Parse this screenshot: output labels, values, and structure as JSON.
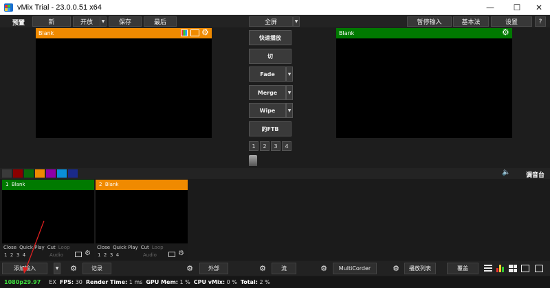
{
  "window": {
    "title": "vMix Trial - 23.0.0.51 x64",
    "min": "—",
    "max": "☐",
    "close": "✕"
  },
  "menubar": {
    "preview_label": "预置",
    "new_label": "新",
    "open_label": "开放",
    "save_label": "保存",
    "recent_label": "最后",
    "fullscreen_label": "全屏",
    "pause_input_label": "暂停输入",
    "basic_label": "基本法",
    "settings_label": "设置",
    "help_label": "?"
  },
  "preview": {
    "title": "Blank",
    "color": "#f08a00"
  },
  "output": {
    "title": "Blank",
    "color": "#007a00"
  },
  "transitions": {
    "quick_play": "快速播放",
    "cut": "切",
    "t1": "Fade",
    "t2": "Merge",
    "t3": "Wipe",
    "ftb": "的FTB",
    "numbers": [
      "1",
      "2",
      "3",
      "4"
    ]
  },
  "swatches": [
    "#3a3a3a",
    "#8b0000",
    "#0a6a0a",
    "#f08a00",
    "#8e00a8",
    "#0a8fd8",
    "#1a2a8a"
  ],
  "audio": {
    "label": "调音台"
  },
  "inputs": [
    {
      "num": "1",
      "name": "Blank",
      "color": "#007a00",
      "links": [
        "Close",
        "Quick Play",
        "Cut",
        "Loop"
      ],
      "nums": [
        "1",
        "2",
        "3",
        "4"
      ],
      "audio": "Audio"
    },
    {
      "num": "2",
      "name": "Blank",
      "color": "#f08a00",
      "links": [
        "Close",
        "Quick Play",
        "Cut",
        "Loop"
      ],
      "nums": [
        "1",
        "2",
        "3",
        "4"
      ],
      "audio": "Audio"
    }
  ],
  "bottombar": {
    "add_input": "添加输入",
    "record": "记录",
    "external": "外部",
    "stream": "流",
    "multicorder": "MultiCorder",
    "playlist": "播放列表",
    "overlay": "覆盖"
  },
  "status": {
    "resolution": "1080p29.97",
    "ex": "EX",
    "fps_label": "FPS:",
    "fps": "30",
    "render_label": "Render Time:",
    "render": "1 ms",
    "gpu_label": "GPU Mem:",
    "gpu": "1 %",
    "cpu_label": "CPU vMix:",
    "cpu": "0 %",
    "total_label": "Total:",
    "total": "2 %"
  },
  "colors": {
    "resolution": "#3fe03f",
    "annotation_arrow": "#e02020"
  }
}
